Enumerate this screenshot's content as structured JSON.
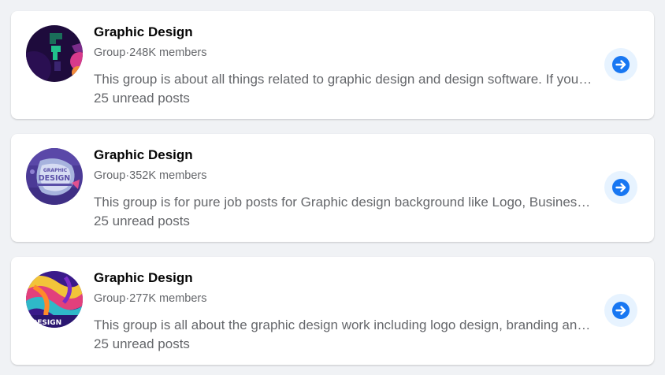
{
  "groups": [
    {
      "name": "Graphic Design",
      "type": "Group",
      "separator": "·",
      "members": "248K members",
      "description": "This group is about all things related to graphic design and design software. If you are a designer, join us.",
      "unread": "25 unread posts",
      "avatar_icon": "graphic-design-avatar-dark"
    },
    {
      "name": "Graphic Design",
      "type": "Group",
      "separator": "·",
      "members": "352K members",
      "description": "This group is for pure job posts for Graphic design background like Logo, Business Card, Flyer and more.",
      "unread": "25 unread posts",
      "avatar_icon": "graphic-design-avatar-purple",
      "avatar_text_top": "GRAPHIC",
      "avatar_text_main": "DESIGN"
    },
    {
      "name": "Graphic Design",
      "type": "Group",
      "separator": "·",
      "members": "277K members",
      "description": "This group is all about the graphic design work including logo design, branding and illustration.",
      "unread": "25 unread posts",
      "avatar_icon": "graphic-design-avatar-colorful",
      "avatar_text_main": "DESIGN"
    }
  ],
  "colors": {
    "page_background": "#f0f2f5",
    "card_background": "#ffffff",
    "title": "#050505",
    "secondary_text": "#65676b",
    "button_background": "#e7f3ff",
    "accent": "#1877f2"
  },
  "action_icon": "arrow-right-circle-icon"
}
